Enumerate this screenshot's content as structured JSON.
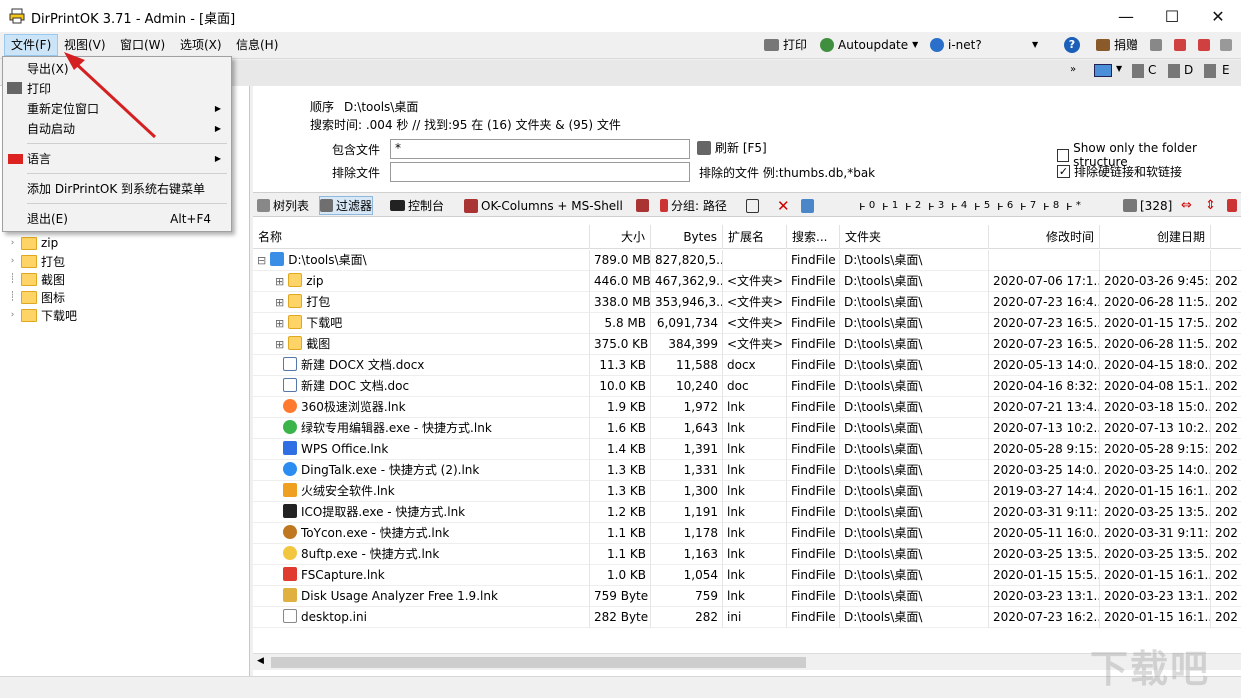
{
  "window": {
    "title": "DirPrintOK 3.71 - Admin - [桌面]",
    "minimize": "—",
    "maximize": "☐",
    "close": "✕"
  },
  "menubar": {
    "items": [
      {
        "label": "文件(F)"
      },
      {
        "label": "视图(V)"
      },
      {
        "label": "窗口(W)"
      },
      {
        "label": "选项(X)"
      },
      {
        "label": "信息(H)"
      }
    ],
    "print_label": "打印",
    "autoupdate_label": "Autoupdate",
    "inet_label": "i-net?",
    "donate_label": "捐赠"
  },
  "file_menu": {
    "items": [
      {
        "label": "导出(X)"
      },
      {
        "label": "打印"
      },
      {
        "label": "重新定位窗口"
      },
      {
        "label": "自动启动"
      },
      {
        "label": "语言"
      },
      {
        "label": "添加 DirPrintOK 到系统右键菜单"
      },
      {
        "label": "退出(E)",
        "shortcut": "Alt+F4"
      }
    ]
  },
  "drives": [
    "C",
    "D",
    "E"
  ],
  "left_tree": {
    "items": [
      {
        "label": "zip"
      },
      {
        "label": "打包"
      },
      {
        "label": "截图"
      },
      {
        "label": "图标"
      },
      {
        "label": "下载吧"
      }
    ]
  },
  "info": {
    "order_label": "顺序",
    "order_path": "D:\\tools\\桌面",
    "search_time": "搜索时间: .004 秒 //  找到:95 在 (16) 文件夹 & (95) 文件",
    "include_label": "包含文件",
    "include_value": "*",
    "exclude_label": "排除文件",
    "exclude_value": "",
    "refresh_label": "刷新 [F5]",
    "excluded_files_hint": "排除的文件 例:thumbs.db,*bak",
    "folder_structure_label": "Show only the folder structure",
    "exclude_links_label": "排除硬链接和软链接",
    "folder_structure_checked": "",
    "exclude_links_checked": "✓"
  },
  "filterbar": {
    "tree_list": "树列表",
    "filter": "过滤器",
    "console": "控制台",
    "columns": "OK-Columns + MS-Shell",
    "group": "分组: 路径",
    "level_labels": [
      "0",
      "1",
      "2",
      "3",
      "4",
      "5",
      "6",
      "7",
      "8",
      "*"
    ],
    "count": "[328]"
  },
  "grid": {
    "columns": [
      "名称",
      "大小",
      "Bytes",
      "扩展名",
      "搜索...",
      "文件夹",
      "修改时间",
      "创建日期",
      ""
    ],
    "rows": [
      {
        "name": "D:\\tools\\桌面\\",
        "size": "789.0 MB",
        "bytes": "827,820,5...",
        "ext": "",
        "search": "FindFile",
        "folder": "D:\\tools\\桌面\\",
        "modified": "",
        "created": "",
        "extra": "",
        "type": "root"
      },
      {
        "name": "zip",
        "size": "446.0 MB",
        "bytes": "467,362,9...",
        "ext": "<文件夹>",
        "search": "FindFile",
        "folder": "D:\\tools\\桌面\\",
        "modified": "2020-07-06 17:1...",
        "created": "2020-03-26 9:45:...",
        "extra": "202",
        "type": "folder"
      },
      {
        "name": "打包",
        "size": "338.0 MB",
        "bytes": "353,946,3...",
        "ext": "<文件夹>",
        "search": "FindFile",
        "folder": "D:\\tools\\桌面\\",
        "modified": "2020-07-23 16:4...",
        "created": "2020-06-28 11:5...",
        "extra": "202",
        "type": "folder"
      },
      {
        "name": "下载吧",
        "size": "5.8 MB",
        "bytes": "6,091,734",
        "ext": "<文件夹>",
        "search": "FindFile",
        "folder": "D:\\tools\\桌面\\",
        "modified": "2020-07-23 16:5...",
        "created": "2020-01-15 17:5...",
        "extra": "202",
        "type": "folder"
      },
      {
        "name": "截图",
        "size": "375.0 KB",
        "bytes": "384,399",
        "ext": "<文件夹>",
        "search": "FindFile",
        "folder": "D:\\tools\\桌面\\",
        "modified": "2020-07-23 16:5...",
        "created": "2020-06-28 11:5...",
        "extra": "202",
        "type": "folder"
      },
      {
        "name": "新建 DOCX 文档.docx",
        "size": "11.3 KB",
        "bytes": "11,588",
        "ext": "docx",
        "search": "FindFile",
        "folder": "D:\\tools\\桌面\\",
        "modified": "2020-05-13 14:0...",
        "created": "2020-04-15 18:0...",
        "extra": "202",
        "type": "doc"
      },
      {
        "name": "新建 DOC 文档.doc",
        "size": "10.0 KB",
        "bytes": "10,240",
        "ext": "doc",
        "search": "FindFile",
        "folder": "D:\\tools\\桌面\\",
        "modified": "2020-04-16 8:32:...",
        "created": "2020-04-08 15:1...",
        "extra": "202",
        "type": "doc"
      },
      {
        "name": "360极速浏览器.lnk",
        "size": "1.9 KB",
        "bytes": "1,972",
        "ext": "lnk",
        "search": "FindFile",
        "folder": "D:\\tools\\桌面\\",
        "modified": "2020-07-21 13:4...",
        "created": "2020-03-18 15:0...",
        "extra": "202",
        "type": "browser360"
      },
      {
        "name": "绿软专用编辑器.exe - 快捷方式.lnk",
        "size": "1.6 KB",
        "bytes": "1,643",
        "ext": "lnk",
        "search": "FindFile",
        "folder": "D:\\tools\\桌面\\",
        "modified": "2020-07-13 10:2...",
        "created": "2020-07-13 10:2...",
        "extra": "202",
        "type": "green"
      },
      {
        "name": "WPS Office.lnk",
        "size": "1.4 KB",
        "bytes": "1,391",
        "ext": "lnk",
        "search": "FindFile",
        "folder": "D:\\tools\\桌面\\",
        "modified": "2020-05-28 9:15:...",
        "created": "2020-05-28 9:15:...",
        "extra": "202",
        "type": "wps"
      },
      {
        "name": "DingTalk.exe - 快捷方式 (2).lnk",
        "size": "1.3 KB",
        "bytes": "1,331",
        "ext": "lnk",
        "search": "FindFile",
        "folder": "D:\\tools\\桌面\\",
        "modified": "2020-03-25 14:0...",
        "created": "2020-03-25 14:0...",
        "extra": "202",
        "type": "ding"
      },
      {
        "name": "火绒安全软件.lnk",
        "size": "1.3 KB",
        "bytes": "1,300",
        "ext": "lnk",
        "search": "FindFile",
        "folder": "D:\\tools\\桌面\\",
        "modified": "2019-03-27 14:4...",
        "created": "2020-01-15 16:1...",
        "extra": "202",
        "type": "huorong"
      },
      {
        "name": "ICO提取器.exe - 快捷方式.lnk",
        "size": "1.2 KB",
        "bytes": "1,191",
        "ext": "lnk",
        "search": "FindFile",
        "folder": "D:\\tools\\桌面\\",
        "modified": "2020-03-31 9:11:...",
        "created": "2020-03-25 13:5...",
        "extra": "202",
        "type": "ico"
      },
      {
        "name": "ToYcon.exe - 快捷方式.lnk",
        "size": "1.1 KB",
        "bytes": "1,178",
        "ext": "lnk",
        "search": "FindFile",
        "folder": "D:\\tools\\桌面\\",
        "modified": "2020-05-11 16:0...",
        "created": "2020-03-31 9:11:...",
        "extra": "202",
        "type": "toycon"
      },
      {
        "name": "8uftp.exe - 快捷方式.lnk",
        "size": "1.1 KB",
        "bytes": "1,163",
        "ext": "lnk",
        "search": "FindFile",
        "folder": "D:\\tools\\桌面\\",
        "modified": "2020-03-25 13:5...",
        "created": "2020-03-25 13:5...",
        "extra": "202",
        "type": "ftp"
      },
      {
        "name": "FSCapture.lnk",
        "size": "1.0 KB",
        "bytes": "1,054",
        "ext": "lnk",
        "search": "FindFile",
        "folder": "D:\\tools\\桌面\\",
        "modified": "2020-01-15 15:5...",
        "created": "2020-01-15 16:1...",
        "extra": "202",
        "type": "fscapture"
      },
      {
        "name": "Disk Usage Analyzer Free 1.9.lnk",
        "size": "759 Byte",
        "bytes": "759",
        "ext": "lnk",
        "search": "FindFile",
        "folder": "D:\\tools\\桌面\\",
        "modified": "2020-03-23 13:1...",
        "created": "2020-03-23 13:1...",
        "extra": "202",
        "type": "disk"
      },
      {
        "name": "desktop.ini",
        "size": "282 Byte",
        "bytes": "282",
        "ext": "ini",
        "search": "FindFile",
        "folder": "D:\\tools\\桌面\\",
        "modified": "2020-07-23 16:2...",
        "created": "2020-01-15 16:1...",
        "extra": "202",
        "type": "ini"
      }
    ]
  },
  "watermark": "下载吧"
}
